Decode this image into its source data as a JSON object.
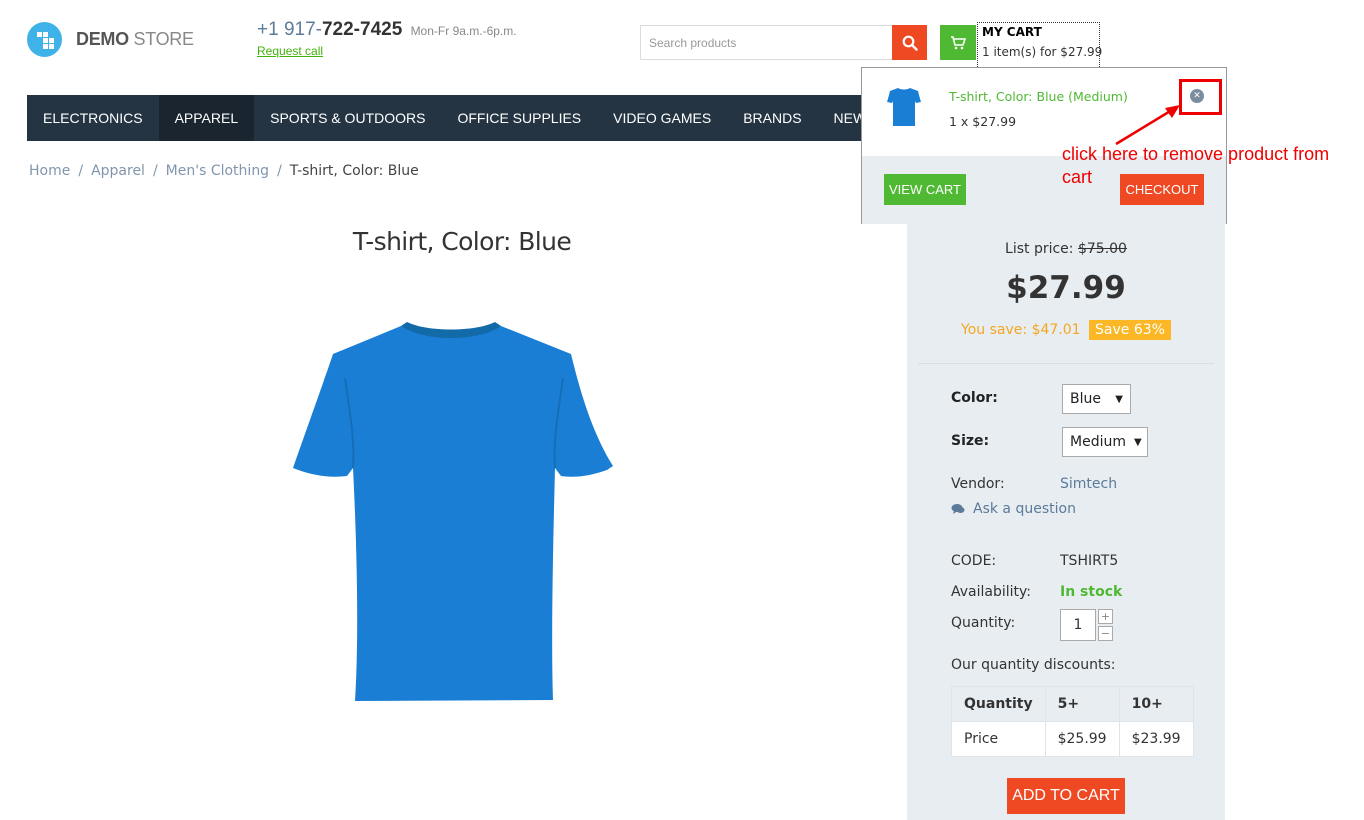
{
  "header": {
    "logo": {
      "brand_bold": "DEMO",
      "brand_light": "STORE"
    },
    "phone": {
      "prefix": "+1 917-",
      "number": "722-7425",
      "hours": "Mon-Fr 9a.m.-6p.m.",
      "request_call": "Request call"
    },
    "search": {
      "placeholder": "Search products"
    },
    "cart": {
      "title": "MY CART",
      "summary": "1 item(s) for $27.99"
    }
  },
  "nav": {
    "items": [
      {
        "label": "ELECTRONICS",
        "active": false
      },
      {
        "label": "APPAREL",
        "active": true
      },
      {
        "label": "SPORTS & OUTDOORS",
        "active": false
      },
      {
        "label": "OFFICE SUPPLIES",
        "active": false
      },
      {
        "label": "VIDEO GAMES",
        "active": false
      },
      {
        "label": "BRANDS",
        "active": false
      },
      {
        "label": "NEWEST",
        "active": false
      }
    ]
  },
  "breadcrumb": {
    "items": [
      "Home",
      "Apparel",
      "Men's Clothing"
    ],
    "current": "T-shirt, Color: Blue"
  },
  "product": {
    "title": "T-shirt, Color: Blue",
    "list_price_label": "List price:",
    "list_price": "$75.00",
    "price": "$27.99",
    "you_save": "You save: $47.01",
    "save_badge": "Save 63%",
    "color_label": "Color:",
    "color_value": "Blue",
    "size_label": "Size:",
    "size_value": "Medium",
    "vendor_label": "Vendor:",
    "vendor_value": "Simtech",
    "ask_question": "Ask a question",
    "code_label": "CODE:",
    "code_value": "TSHIRT5",
    "availability_label": "Availability:",
    "availability_value": "In stock",
    "quantity_label": "Quantity:",
    "quantity_value": "1",
    "qty_plus": "+",
    "qty_minus": "−",
    "discounts_label": "Our quantity discounts:",
    "discounts_table": {
      "header": [
        "Quantity",
        "5+",
        "10+"
      ],
      "row": [
        "Price",
        "$25.99",
        "$23.99"
      ]
    },
    "add_to_cart": "ADD TO CART"
  },
  "cart_dropdown": {
    "item_name": "T-shirt, Color: Blue (Medium)",
    "item_qty": "1 x $27.99",
    "view_cart": "VIEW CART",
    "checkout": "CHECKOUT"
  },
  "annotation": {
    "text": "click here to remove product from cart",
    "color": "#ee0000"
  },
  "colors": {
    "accent_orange": "#ef4923",
    "accent_green": "#4fb933",
    "nav_bg": "#253443",
    "product_blue": "#1a7fd4"
  },
  "icons": {
    "search": "search-icon",
    "cart": "cart-icon",
    "remove": "close-circle-icon",
    "chat": "chat-bubble-icon"
  }
}
